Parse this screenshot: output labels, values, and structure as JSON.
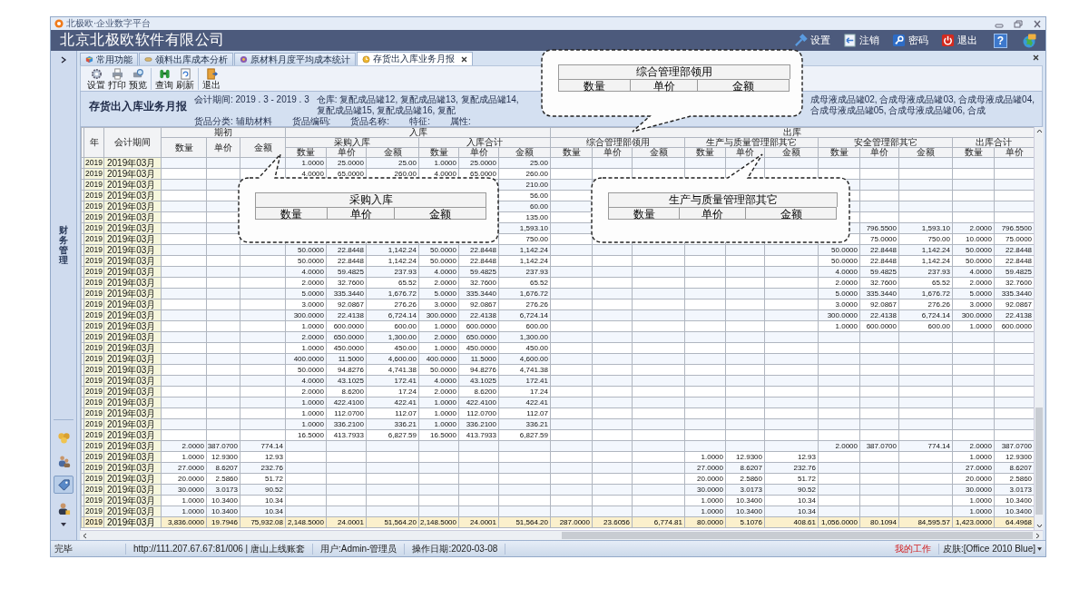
{
  "window": {
    "title": "北极欧·企业数字平台",
    "company": "北京北极欧软件有限公司"
  },
  "header_actions": [
    {
      "kind": "settings",
      "label": "设置"
    },
    {
      "kind": "logout",
      "label": "注销"
    },
    {
      "kind": "password",
      "label": "密码"
    },
    {
      "kind": "exit",
      "label": "退出"
    }
  ],
  "help_label": "?",
  "sidebar": {
    "section_label": "财务管理",
    "tools": [
      {
        "selected": false
      },
      {
        "selected": false
      },
      {
        "selected": true
      },
      {
        "selected": false
      }
    ]
  },
  "tabs": [
    {
      "label": "常用功能",
      "selected": false
    },
    {
      "label": "领料出库成本分析",
      "selected": false
    },
    {
      "label": "原材料月度平均成本统计",
      "selected": false
    },
    {
      "label": "存货出入库业务月报",
      "selected": true
    }
  ],
  "toolbar": [
    {
      "items": [
        {
          "kind": "settings",
          "label": "设置"
        },
        {
          "kind": "print",
          "label": "打印"
        },
        {
          "kind": "preview",
          "label": "预览"
        }
      ]
    },
    {
      "items": [
        {
          "kind": "query",
          "label": "查询"
        },
        {
          "kind": "refresh",
          "label": "刷新"
        }
      ]
    },
    {
      "items": [
        {
          "kind": "exit",
          "label": "退出"
        }
      ]
    }
  ],
  "report": {
    "title": "存货出入库业务月报",
    "period": "会计期间: 2019 . 3 - 2019 . 3",
    "warehouse_left": "仓库: 复配成品罐12, 复配成品罐13, 复配成品罐14, 复配成品罐15, 复配成品罐16, 复配",
    "warehouse_right": "成母液成品罐02, 合成母液成品罐03, 合成母液成品罐04, 合成母液成品罐05, 合成母液成品罐06, 合成",
    "filters": [
      "货品分类: 辅助材料",
      "货品编码:",
      "货品名称:",
      "特征:",
      "属性:"
    ]
  },
  "table": {
    "header": {
      "year": "年",
      "period": "会计期间",
      "sections": [
        {
          "label": "期初",
          "columns": [
            "数量",
            "单价",
            "金额"
          ]
        },
        {
          "label": "入库",
          "groups": [
            {
              "label": "采购入库",
              "columns": [
                "数量",
                "单价",
                "金额"
              ]
            },
            {
              "label": "入库合计",
              "columns": [
                "数量",
                "单价",
                "金额"
              ]
            }
          ]
        },
        {
          "label": "出库",
          "groups": [
            {
              "label": "综合管理部领用",
              "columns": [
                "数量",
                "单价",
                "金额"
              ]
            },
            {
              "label": "生产与质量管理部其它",
              "columns": [
                "数量",
                "单价",
                "金额"
              ]
            },
            {
              "label": "安全管理部其它",
              "columns": [
                "数量",
                "单价",
                "金额"
              ]
            },
            {
              "label": "出库合计",
              "columns": [
                "数量",
                "单价"
              ]
            }
          ]
        }
      ]
    },
    "rows": [
      {
        "kind": "data",
        "cells": [
          "2019",
          "2019年03月",
          null,
          null,
          null,
          "1.0000",
          "25.0000",
          "25.00",
          "1.0000",
          "25.0000",
          "25.00",
          null,
          null,
          null,
          null,
          null,
          null,
          null,
          null,
          null,
          null,
          null
        ]
      },
      {
        "kind": "data",
        "cells": [
          "2019",
          "2019年03月",
          null,
          null,
          null,
          "4.0000",
          "65.0000",
          "260.00",
          "4.0000",
          "65.0000",
          "260.00",
          null,
          null,
          null,
          null,
          null,
          null,
          null,
          null,
          null,
          null,
          null
        ]
      },
      {
        "kind": "data",
        "cells": [
          "2019",
          "2019年03月",
          null,
          null,
          null,
          null,
          null,
          null,
          null,
          null,
          "210.00",
          null,
          null,
          null,
          null,
          null,
          null,
          null,
          null,
          null,
          null,
          null
        ]
      },
      {
        "kind": "data",
        "cells": [
          "2019",
          "2019年03月",
          null,
          null,
          null,
          null,
          null,
          null,
          null,
          null,
          "56.00",
          null,
          null,
          null,
          null,
          null,
          null,
          null,
          null,
          null,
          null,
          null
        ]
      },
      {
        "kind": "data",
        "cells": [
          "2019",
          "2019年03月",
          null,
          null,
          null,
          null,
          null,
          null,
          null,
          null,
          "60.00",
          null,
          null,
          null,
          null,
          null,
          null,
          null,
          null,
          null,
          null,
          null
        ]
      },
      {
        "kind": "data",
        "cells": [
          "2019",
          "2019年03月",
          null,
          null,
          null,
          null,
          null,
          null,
          null,
          null,
          "135.00",
          null,
          null,
          null,
          null,
          null,
          null,
          null,
          null,
          null,
          null,
          null
        ]
      },
      {
        "kind": "data",
        "cells": [
          "2019",
          "2019年03月",
          null,
          null,
          null,
          null,
          null,
          null,
          null,
          null,
          "1,593.10",
          null,
          null,
          null,
          null,
          null,
          null,
          null,
          "796.5500",
          "1,593.10",
          "2.0000",
          "796.5500"
        ]
      },
      {
        "kind": "data",
        "cells": [
          "2019",
          "2019年03月",
          null,
          null,
          null,
          null,
          null,
          null,
          null,
          null,
          "750.00",
          null,
          null,
          null,
          null,
          null,
          null,
          null,
          "75.0000",
          "750.00",
          "10.0000",
          "75.0000"
        ]
      },
      {
        "kind": "data",
        "cells": [
          "2019",
          "2019年03月",
          null,
          null,
          null,
          "50.0000",
          "22.8448",
          "1,142.24",
          "50.0000",
          "22.8448",
          "1,142.24",
          null,
          null,
          null,
          null,
          null,
          null,
          "50.0000",
          "22.8448",
          "1,142.24",
          "50.0000",
          "22.8448"
        ]
      },
      {
        "kind": "data",
        "cells": [
          "2019",
          "2019年03月",
          null,
          null,
          null,
          "50.0000",
          "22.8448",
          "1,142.24",
          "50.0000",
          "22.8448",
          "1,142.24",
          null,
          null,
          null,
          null,
          null,
          null,
          "50.0000",
          "22.8448",
          "1,142.24",
          "50.0000",
          "22.8448"
        ]
      },
      {
        "kind": "data",
        "cells": [
          "2019",
          "2019年03月",
          null,
          null,
          null,
          "4.0000",
          "59.4825",
          "237.93",
          "4.0000",
          "59.4825",
          "237.93",
          null,
          null,
          null,
          null,
          null,
          null,
          "4.0000",
          "59.4825",
          "237.93",
          "4.0000",
          "59.4825"
        ]
      },
      {
        "kind": "data",
        "cells": [
          "2019",
          "2019年03月",
          null,
          null,
          null,
          "2.0000",
          "32.7600",
          "65.52",
          "2.0000",
          "32.7600",
          "65.52",
          null,
          null,
          null,
          null,
          null,
          null,
          "2.0000",
          "32.7600",
          "65.52",
          "2.0000",
          "32.7600"
        ]
      },
      {
        "kind": "data",
        "cells": [
          "2019",
          "2019年03月",
          null,
          null,
          null,
          "5.0000",
          "335.3440",
          "1,676.72",
          "5.0000",
          "335.3440",
          "1,676.72",
          null,
          null,
          null,
          null,
          null,
          null,
          "5.0000",
          "335.3440",
          "1,676.72",
          "5.0000",
          "335.3440"
        ]
      },
      {
        "kind": "data",
        "cells": [
          "2019",
          "2019年03月",
          null,
          null,
          null,
          "3.0000",
          "92.0867",
          "276.26",
          "3.0000",
          "92.0867",
          "276.26",
          null,
          null,
          null,
          null,
          null,
          null,
          "3.0000",
          "92.0867",
          "276.26",
          "3.0000",
          "92.0867"
        ]
      },
      {
        "kind": "data",
        "cells": [
          "2019",
          "2019年03月",
          null,
          null,
          null,
          "300.0000",
          "22.4138",
          "6,724.14",
          "300.0000",
          "22.4138",
          "6,724.14",
          null,
          null,
          null,
          null,
          null,
          null,
          "300.0000",
          "22.4138",
          "6,724.14",
          "300.0000",
          "22.4138"
        ]
      },
      {
        "kind": "data",
        "cells": [
          "2019",
          "2019年03月",
          null,
          null,
          null,
          "1.0000",
          "600.0000",
          "600.00",
          "1.0000",
          "600.0000",
          "600.00",
          null,
          null,
          null,
          null,
          null,
          null,
          "1.0000",
          "600.0000",
          "600.00",
          "1.0000",
          "600.0000"
        ]
      },
      {
        "kind": "data",
        "cells": [
          "2019",
          "2019年03月",
          null,
          null,
          null,
          "2.0000",
          "650.0000",
          "1,300.00",
          "2.0000",
          "650.0000",
          "1,300.00",
          null,
          null,
          null,
          null,
          null,
          null,
          null,
          null,
          null,
          null,
          null
        ]
      },
      {
        "kind": "data",
        "cells": [
          "2019",
          "2019年03月",
          null,
          null,
          null,
          "1.0000",
          "450.0000",
          "450.00",
          "1.0000",
          "450.0000",
          "450.00",
          null,
          null,
          null,
          null,
          null,
          null,
          null,
          null,
          null,
          null,
          null
        ]
      },
      {
        "kind": "data",
        "cells": [
          "2019",
          "2019年03月",
          null,
          null,
          null,
          "400.0000",
          "11.5000",
          "4,600.00",
          "400.0000",
          "11.5000",
          "4,600.00",
          null,
          null,
          null,
          null,
          null,
          null,
          null,
          null,
          null,
          null,
          null
        ]
      },
      {
        "kind": "data",
        "cells": [
          "2019",
          "2019年03月",
          null,
          null,
          null,
          "50.0000",
          "94.8276",
          "4,741.38",
          "50.0000",
          "94.8276",
          "4,741.38",
          null,
          null,
          null,
          null,
          null,
          null,
          null,
          null,
          null,
          null,
          null
        ]
      },
      {
        "kind": "data",
        "cells": [
          "2019",
          "2019年03月",
          null,
          null,
          null,
          "4.0000",
          "43.1025",
          "172.41",
          "4.0000",
          "43.1025",
          "172.41",
          null,
          null,
          null,
          null,
          null,
          null,
          null,
          null,
          null,
          null,
          null
        ]
      },
      {
        "kind": "data",
        "cells": [
          "2019",
          "2019年03月",
          null,
          null,
          null,
          "2.0000",
          "8.6200",
          "17.24",
          "2.0000",
          "8.6200",
          "17.24",
          null,
          null,
          null,
          null,
          null,
          null,
          null,
          null,
          null,
          null,
          null
        ]
      },
      {
        "kind": "data",
        "cells": [
          "2019",
          "2019年03月",
          null,
          null,
          null,
          "1.0000",
          "422.4100",
          "422.41",
          "1.0000",
          "422.4100",
          "422.41",
          null,
          null,
          null,
          null,
          null,
          null,
          null,
          null,
          null,
          null,
          null
        ]
      },
      {
        "kind": "data",
        "cells": [
          "2019",
          "2019年03月",
          null,
          null,
          null,
          "1.0000",
          "112.0700",
          "112.07",
          "1.0000",
          "112.0700",
          "112.07",
          null,
          null,
          null,
          null,
          null,
          null,
          null,
          null,
          null,
          null,
          null
        ]
      },
      {
        "kind": "data",
        "cells": [
          "2019",
          "2019年03月",
          null,
          null,
          null,
          "1.0000",
          "336.2100",
          "336.21",
          "1.0000",
          "336.2100",
          "336.21",
          null,
          null,
          null,
          null,
          null,
          null,
          null,
          null,
          null,
          null,
          null
        ]
      },
      {
        "kind": "data",
        "cells": [
          "2019",
          "2019年03月",
          null,
          null,
          null,
          "16.5000",
          "413.7933",
          "6,827.59",
          "16.5000",
          "413.7933",
          "6,827.59",
          null,
          null,
          null,
          null,
          null,
          null,
          null,
          null,
          null,
          null,
          null
        ]
      },
      {
        "kind": "data",
        "cells": [
          "2019",
          "2019年03月",
          "2.0000",
          "387.0700",
          "774.14",
          null,
          null,
          null,
          null,
          null,
          null,
          null,
          null,
          null,
          null,
          null,
          null,
          "2.0000",
          "387.0700",
          "774.14",
          "2.0000",
          "387.0700"
        ]
      },
      {
        "kind": "data",
        "cells": [
          "2019",
          "2019年03月",
          "1.0000",
          "12.9300",
          "12.93",
          null,
          null,
          null,
          null,
          null,
          null,
          null,
          null,
          null,
          "1.0000",
          "12.9300",
          "12.93",
          null,
          null,
          null,
          "1.0000",
          "12.9300"
        ]
      },
      {
        "kind": "data",
        "cells": [
          "2019",
          "2019年03月",
          "27.0000",
          "8.6207",
          "232.76",
          null,
          null,
          null,
          null,
          null,
          null,
          null,
          null,
          null,
          "27.0000",
          "8.6207",
          "232.76",
          null,
          null,
          null,
          "27.0000",
          "8.6207"
        ]
      },
      {
        "kind": "data",
        "cells": [
          "2019",
          "2019年03月",
          "20.0000",
          "2.5860",
          "51.72",
          null,
          null,
          null,
          null,
          null,
          null,
          null,
          null,
          null,
          "20.0000",
          "2.5860",
          "51.72",
          null,
          null,
          null,
          "20.0000",
          "2.5860"
        ]
      },
      {
        "kind": "data",
        "cells": [
          "2019",
          "2019年03月",
          "30.0000",
          "3.0173",
          "90.52",
          null,
          null,
          null,
          null,
          null,
          null,
          null,
          null,
          null,
          "30.0000",
          "3.0173",
          "90.52",
          null,
          null,
          null,
          "30.0000",
          "3.0173"
        ]
      },
      {
        "kind": "data",
        "cells": [
          "2019",
          "2019年03月",
          "1.0000",
          "10.3400",
          "10.34",
          null,
          null,
          null,
          null,
          null,
          null,
          null,
          null,
          null,
          "1.0000",
          "10.3400",
          "10.34",
          null,
          null,
          null,
          "1.0000",
          "10.3400"
        ]
      },
      {
        "kind": "data",
        "cells": [
          "2019",
          "2019年03月",
          "1.0000",
          "10.3400",
          "10.34",
          null,
          null,
          null,
          null,
          null,
          null,
          null,
          null,
          null,
          "1.0000",
          "10.3400",
          "10.34",
          null,
          null,
          null,
          "1.0000",
          "10.3400"
        ]
      },
      {
        "kind": "total",
        "cells": [
          "2019",
          "2019年03月",
          "3,836.0000",
          "19.7946",
          "75,932.08",
          "2,148.5000",
          "24.0001",
          "51,564.20",
          "2,148.5000",
          "24.0001",
          "51,564.20",
          "287.0000",
          "23.6056",
          "6,774.81",
          "80.0000",
          "5.1076",
          "408.61",
          "1,056.0000",
          "80.1094",
          "84,595.57",
          "1,423.0000",
          "64.4968"
        ]
      }
    ]
  },
  "callouts": [
    {
      "title": "综合管理部领用",
      "columns": [
        "数量",
        "单价",
        "金额"
      ]
    },
    {
      "title": "采购入库",
      "columns": [
        "数量",
        "单价",
        "金额"
      ]
    },
    {
      "title": "生产与质量管理部其它",
      "columns": [
        "数量",
        "单价",
        "金额"
      ]
    }
  ],
  "status_bar": {
    "state": "完毕",
    "server": "http://111.207.67.67:81/006 | 唐山上线账套",
    "user": "用户:Admin-管理员",
    "date": "操作日期:2020-03-08",
    "my_work": "我的工作",
    "skin": "皮肤:[Office 2010 Blue]"
  }
}
